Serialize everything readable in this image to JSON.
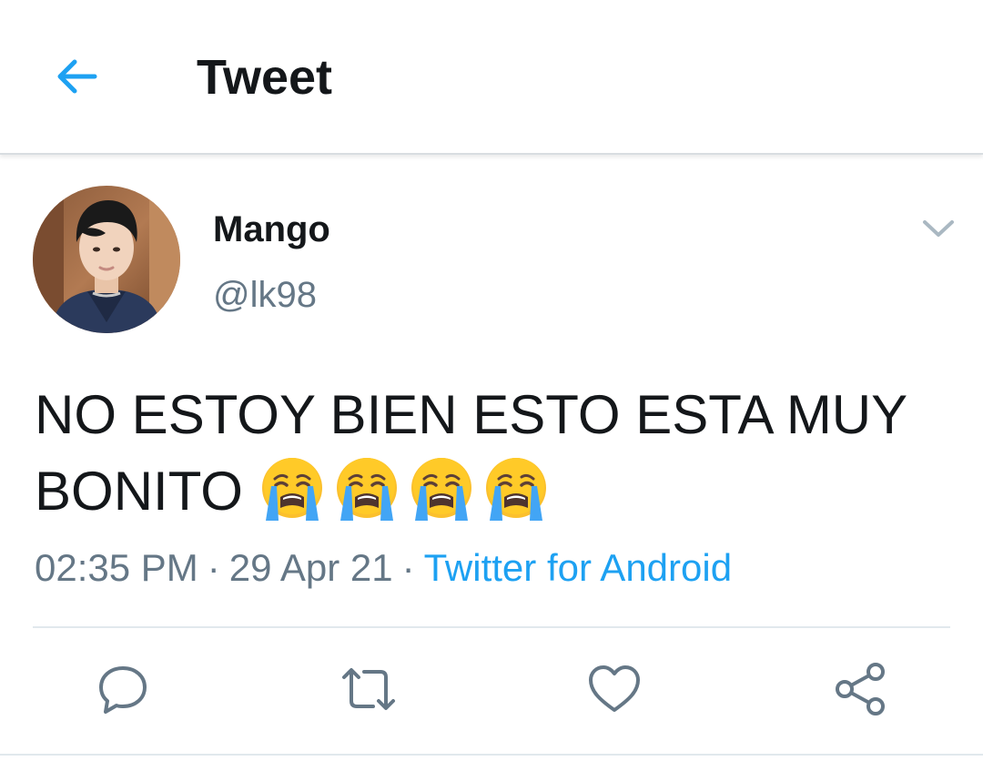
{
  "header": {
    "title": "Tweet",
    "back_icon": "arrow-left-icon"
  },
  "tweet": {
    "author": {
      "display_name": "Mango",
      "handle": "@lk98"
    },
    "text": "NO ESTOY BIEN ESTO ESTA MUY BONITO",
    "emojis": [
      "loudly-crying-face",
      "loudly-crying-face",
      "loudly-crying-face",
      "loudly-crying-face"
    ],
    "time": "02:35 PM",
    "date": "29 Apr 21",
    "separator": "·",
    "source": "Twitter for Android",
    "actions": [
      "reply-icon",
      "retweet-icon",
      "like-icon",
      "share-icon"
    ]
  },
  "colors": {
    "accent": "#1da1f2",
    "text_primary": "#14171a",
    "text_secondary": "#657786",
    "icon": "#657786",
    "divider": "#e1e8ed"
  }
}
